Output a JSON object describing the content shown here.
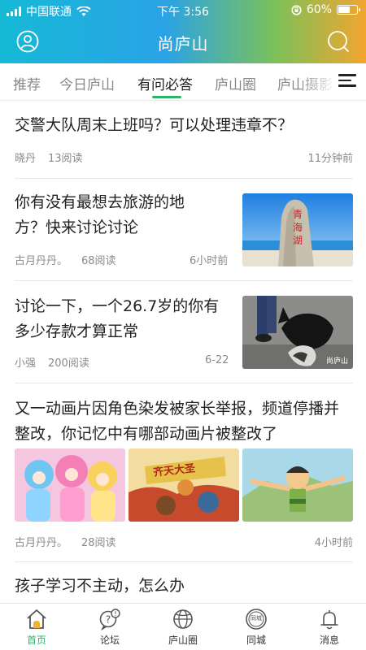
{
  "status_bar": {
    "carrier": "中国联通",
    "time": "下午 3:56",
    "battery": "60%"
  },
  "header": {
    "title": "尚庐山",
    "left_icon": "user-icon",
    "right_icon": "search-icon"
  },
  "tabs": [
    {
      "label": "推荐",
      "active": false
    },
    {
      "label": "今日庐山",
      "active": false
    },
    {
      "label": "有问必答",
      "active": true
    },
    {
      "label": "庐山圈",
      "active": false
    },
    {
      "label": "庐山摄影",
      "active": false
    }
  ],
  "feed": [
    {
      "title": "交警大队周末上班吗？可以处理违章不？",
      "author": "晓丹",
      "reads": "13阅读",
      "time": "11分钟前"
    },
    {
      "title": "你有没有最想去旅游的地方？快来讨论讨论",
      "author": "古月丹丹。",
      "reads": "68阅读",
      "time": "6小时前",
      "image_text": "青海湖"
    },
    {
      "title": "讨论一下，一个26.7岁的你有多少存款才算正常",
      "author": "小强",
      "reads": "200阅读",
      "time": "6-22",
      "image_watermark": "尚庐山"
    },
    {
      "title": "又一动画片因角色染发被家长举报，频道停播并整改，你记忆中有哪部动画片被整改了",
      "author": "古月丹丹。",
      "reads": "28阅读",
      "time": "4小时前",
      "image_caption": "齐天大圣"
    },
    {
      "title": "孩子学习不主动，怎么办"
    }
  ],
  "tabbar": [
    {
      "label": "首页",
      "icon": "home-icon",
      "active": true
    },
    {
      "label": "论坛",
      "icon": "forum-icon",
      "active": false
    },
    {
      "label": "庐山圈",
      "icon": "globe-icon",
      "active": false
    },
    {
      "label": "同城",
      "icon": "same-city-icon",
      "active": false,
      "badge_text": "同城"
    },
    {
      "label": "消息",
      "icon": "bell-icon",
      "active": false
    }
  ],
  "colors": {
    "accent": "#2db46b",
    "header_gradient": [
      "#16b9d6",
      "#2aa3e6",
      "#7bc15a",
      "#f2a52f"
    ]
  }
}
